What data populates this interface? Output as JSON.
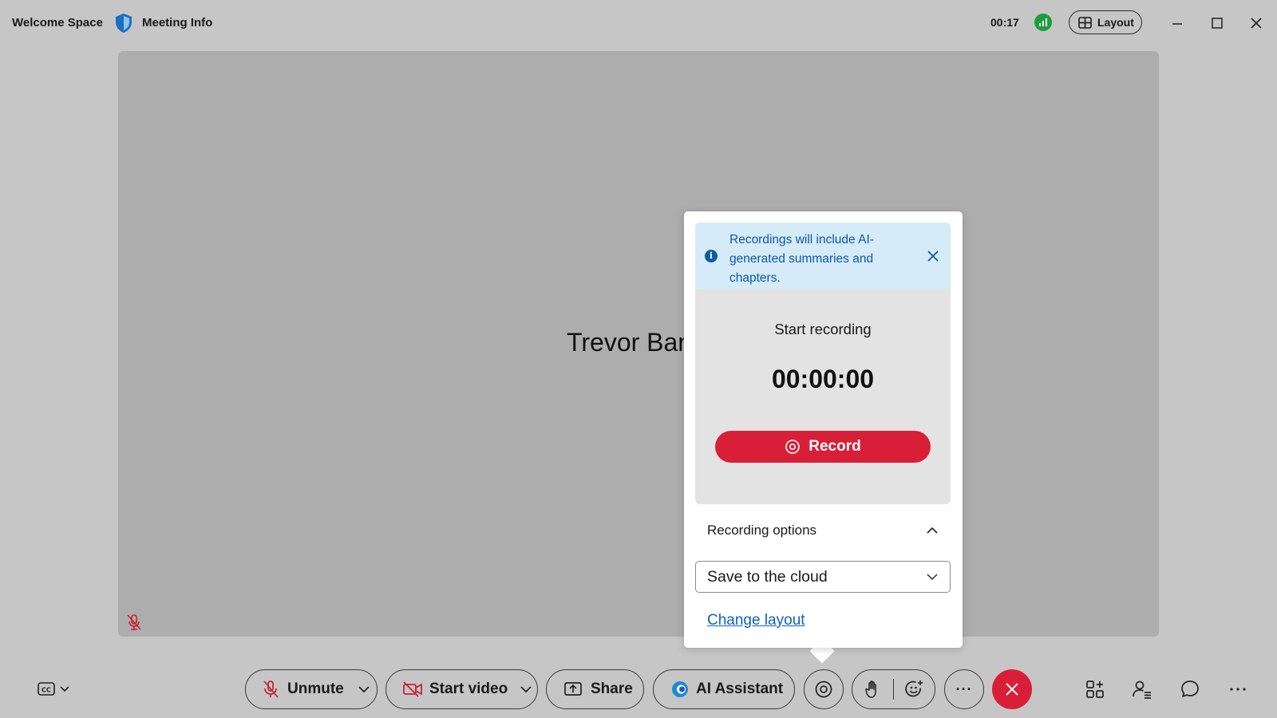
{
  "titlebar": {
    "space_name": "Welcome Space",
    "meeting_info": "Meeting Info",
    "timer": "00:17",
    "layout_label": "Layout"
  },
  "stage": {
    "participant_name": "Trevor Ban"
  },
  "recording_popover": {
    "banner_text": "Recordings will include AI-generated summaries and chapters.",
    "title": "Start recording",
    "elapsed": "00:00:00",
    "record_label": "Record",
    "options_label": "Recording options",
    "destination": "Save to the cloud",
    "change_layout_link": "Change layout"
  },
  "toolbar": {
    "unmute_label": "Unmute",
    "start_video_label": "Start video",
    "share_label": "Share",
    "ai_assistant_label": "AI Assistant",
    "more_label": "···"
  },
  "colors": {
    "accent_red": "#d91f38",
    "info_blue": "#0b5aa8",
    "link_blue": "#0b63c2",
    "signal_green": "#1d9e3e"
  },
  "icons": [
    "shield-icon",
    "signal-icon",
    "layout-grid-icon",
    "minimize-icon",
    "maximize-icon",
    "close-icon",
    "mic-off-icon",
    "info-icon",
    "record-icon",
    "chevron-up-icon",
    "chevron-down-icon",
    "captions-icon",
    "video-off-icon",
    "share-screen-icon",
    "ai-assistant-icon",
    "raise-hand-icon",
    "reaction-icon",
    "end-call-icon",
    "apps-icon",
    "participants-icon",
    "chat-icon",
    "more-icon"
  ]
}
